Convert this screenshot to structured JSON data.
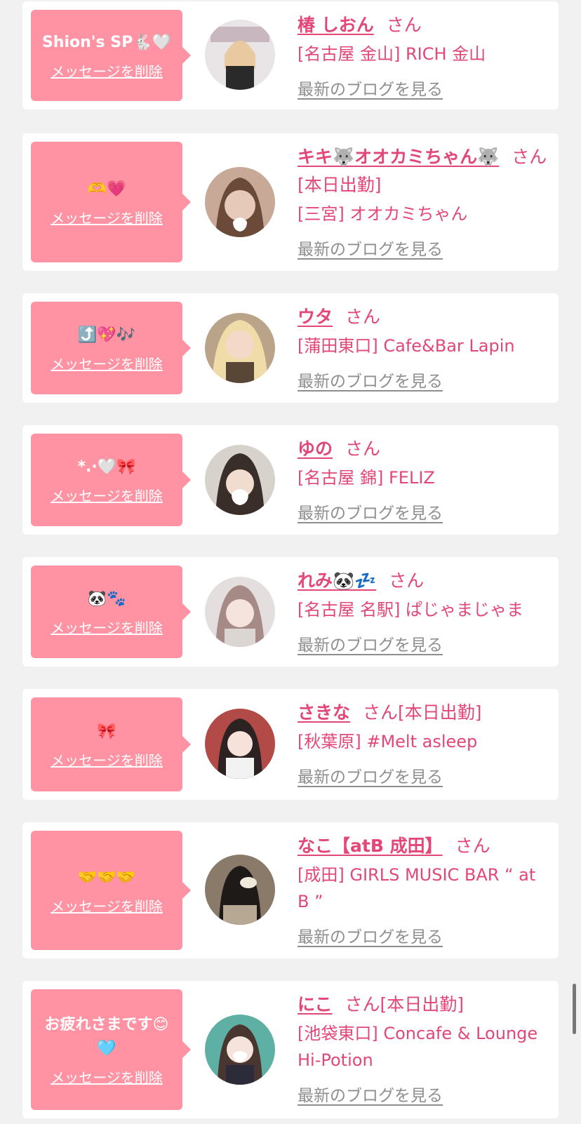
{
  "cards": [
    {
      "message": "Shion's SP🐇🤍",
      "delete_label": "メッセージを削除",
      "name": "椿 しおん",
      "honorific": "さん",
      "extra": "",
      "shop": "[名古屋 金山] RICH 金山",
      "blog_label": "最新のブログを見る"
    },
    {
      "message": "🫶💗",
      "delete_label": "メッセージを削除",
      "name": "キキ🐺オオカミちゃん🐺",
      "honorific": "さん",
      "extra": "[本日出勤]",
      "shop": "[三宮] オオカミちゃん",
      "blog_label": "最新のブログを見る"
    },
    {
      "message": "⤴️💖🎶",
      "delete_label": "メッセージを削除",
      "name": "ウタ",
      "honorific": "さん",
      "extra": "",
      "shop": "[蒲田東口] Cafe&Bar Lapin",
      "blog_label": "最新のブログを見る"
    },
    {
      "message": "*.·🤍🎀",
      "delete_label": "メッセージを削除",
      "name": "ゆの",
      "honorific": "さん",
      "extra": "",
      "shop": "[名古屋 錦] FELIZ",
      "blog_label": "最新のブログを見る"
    },
    {
      "message": "🐼🐾",
      "delete_label": "メッセージを削除",
      "name": "れみ🐼💤",
      "honorific": "さん",
      "extra": "",
      "shop": "[名古屋 名駅] ぱじゃまじゃま",
      "blog_label": "最新のブログを見る"
    },
    {
      "message": "🎀",
      "delete_label": "メッセージを削除",
      "name": "さきな",
      "honorific": "さん",
      "extra": "[本日出勤]",
      "shop": "[秋葉原] #Melt asleep",
      "blog_label": "最新のブログを見る"
    },
    {
      "message": "🤝🤝🤝",
      "delete_label": "メッセージを削除",
      "name": "なこ【atB 成田】",
      "honorific": "さん",
      "extra": "",
      "shop": "[成田] GIRLS MUSIC BAR “ at B ”",
      "blog_label": "最新のブログを見る"
    },
    {
      "message": "お疲れさまです😊🩵",
      "delete_label": "メッセージを削除",
      "name": "にこ",
      "honorific": "さん",
      "extra": "[本日出勤]",
      "shop": "[池袋東口] Concafe & Lounge Hi-Potion",
      "blog_label": "最新のブログを見る"
    }
  ],
  "colors": {
    "accent": "#e34777",
    "bubble": "#ff93a3",
    "background": "#f1f1f1",
    "link_gray": "#8e8e8e"
  }
}
